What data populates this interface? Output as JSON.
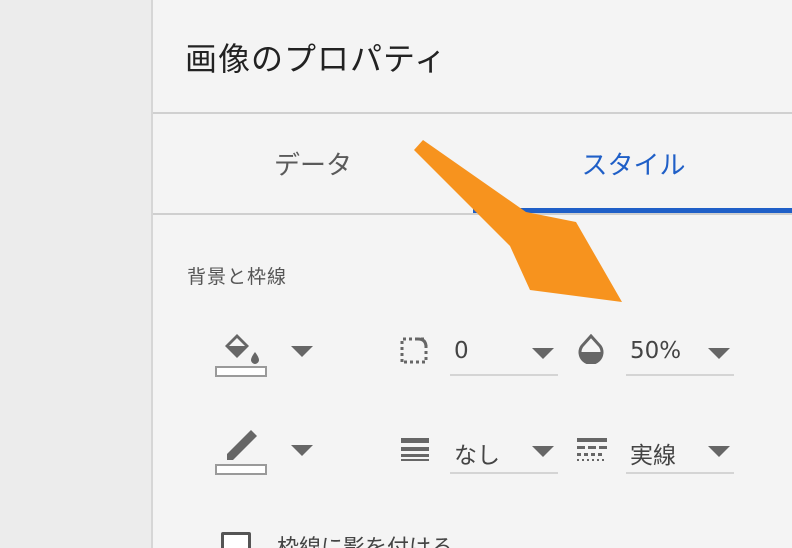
{
  "panel": {
    "title": "画像のプロパティ",
    "tabs": [
      {
        "label": "データ",
        "active": false
      },
      {
        "label": "スタイル",
        "active": true
      }
    ],
    "accent_color": "#1f5fc7"
  },
  "section": {
    "label": "背景と枠線"
  },
  "row1": {
    "fill_color_icon": "fill-bucket-icon",
    "border_radius_icon": "border-radius-icon",
    "border_radius_value": "0",
    "opacity_icon": "opacity-icon",
    "opacity_value": "50%"
  },
  "row2": {
    "border_color_icon": "pen-icon",
    "border_weight_icon": "line-weight-icon",
    "border_weight_value": "なし",
    "border_style_icon": "line-style-icon",
    "border_style_value": "実線"
  },
  "shadow_checkbox": {
    "label": "枠線に影を付ける",
    "checked": false
  },
  "annotation": {
    "arrow_color": "#f7931e"
  }
}
